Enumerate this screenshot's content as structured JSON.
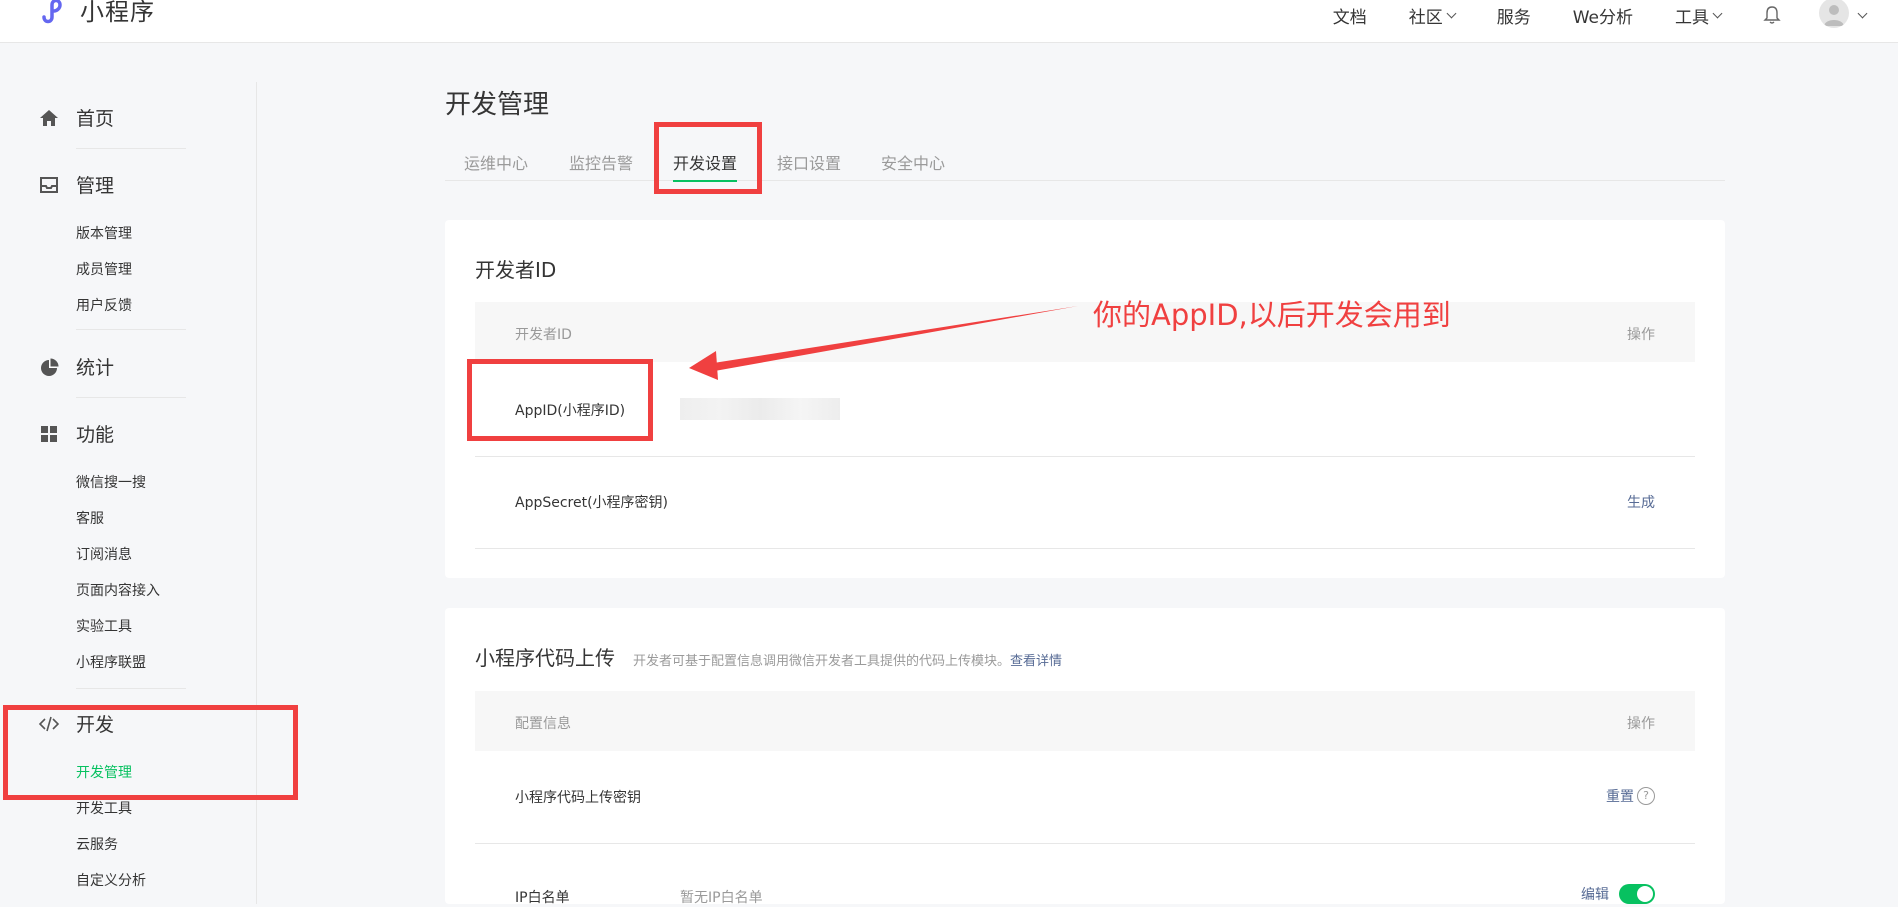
{
  "app": {
    "logo_text": "小程序"
  },
  "topnav": {
    "items": [
      "文档",
      "社区",
      "服务",
      "We分析",
      "工具"
    ]
  },
  "sidebar": {
    "home": "首页",
    "manage": "管理",
    "manage_items": [
      "版本管理",
      "成员管理",
      "用户反馈"
    ],
    "stats": "统计",
    "features": "功能",
    "feature_items": [
      "微信搜一搜",
      "客服",
      "订阅消息",
      "页面内容接入",
      "实验工具",
      "小程序联盟"
    ],
    "dev": "开发",
    "dev_items": [
      "开发管理",
      "开发工具",
      "云服务",
      "自定义分析"
    ]
  },
  "page": {
    "title": "开发管理",
    "tabs": [
      "运维中心",
      "监控告警",
      "开发设置",
      "接口设置",
      "安全中心"
    ]
  },
  "dev_id_card": {
    "title": "开发者ID",
    "col_name": "开发者ID",
    "col_action": "操作",
    "appid_label": "AppID(小程序ID)",
    "secret_label": "AppSecret(小程序密钥)",
    "secret_action": "生成"
  },
  "upload_card": {
    "title": "小程序代码上传",
    "desc": "开发者可基于配置信息调用微信开发者工具提供的代码上传模块。",
    "desc_link": "查看详情",
    "col_name": "配置信息",
    "col_action": "操作",
    "key_label": "小程序代码上传密钥",
    "key_action": "重置",
    "ip_label": "IP白名单",
    "ip_value": "暂无IP白名单",
    "ip_action": "编辑"
  },
  "annotation": {
    "text": "你的AppID,以后开发会用到",
    "color": "#f04040"
  },
  "colors": {
    "accent": "#07c160",
    "link": "#576b95",
    "annotation": "#f04040"
  }
}
